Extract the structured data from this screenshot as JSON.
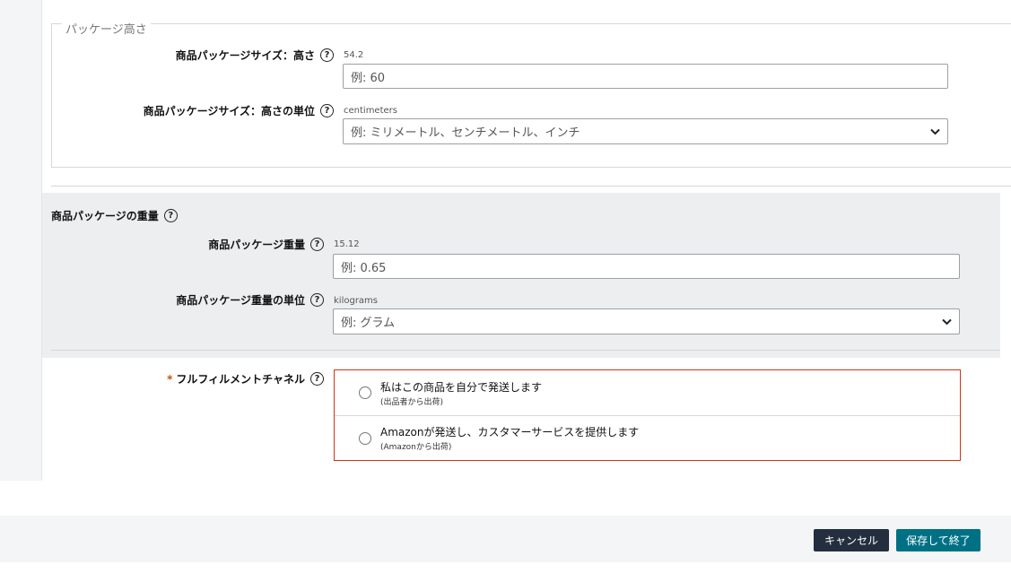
{
  "height_group": {
    "legend": "パッケージ高さ",
    "height": {
      "label": "商品パッケージサイズ：高さ",
      "current": "54.2",
      "placeholder": "例: 60"
    },
    "height_unit": {
      "label": "商品パッケージサイズ：高さの単位",
      "current": "centimeters",
      "placeholder": "例: ミリメートル、センチメートル、インチ"
    }
  },
  "weight_group": {
    "title": "商品パッケージの重量",
    "weight": {
      "label": "商品パッケージ重量",
      "current": "15.12",
      "placeholder": "例: 0.65"
    },
    "weight_unit": {
      "label": "商品パッケージ重量の単位",
      "current": "kilograms",
      "placeholder": "例: グラム"
    }
  },
  "fulfillment": {
    "required_mark": "*",
    "label": "フルフィルメントチャネル",
    "options": [
      {
        "main": "私はこの商品を自分で発送します",
        "sub": "(出品者から出荷)"
      },
      {
        "main": "Amazonが発送し、カスタマーサービスを提供します",
        "sub": "(Amazonから出荷)"
      }
    ]
  },
  "help_glyph": "?",
  "icons": {
    "help": "help-circle-icon",
    "select": "chevron-down-icon"
  },
  "footer": {
    "cancel_label": "キャンセル",
    "save_label": "保存して終了"
  },
  "colors": {
    "error_border": "#d13212",
    "save_button": "#007185",
    "cancel_button": "#232f3e",
    "required": "#c45500"
  }
}
